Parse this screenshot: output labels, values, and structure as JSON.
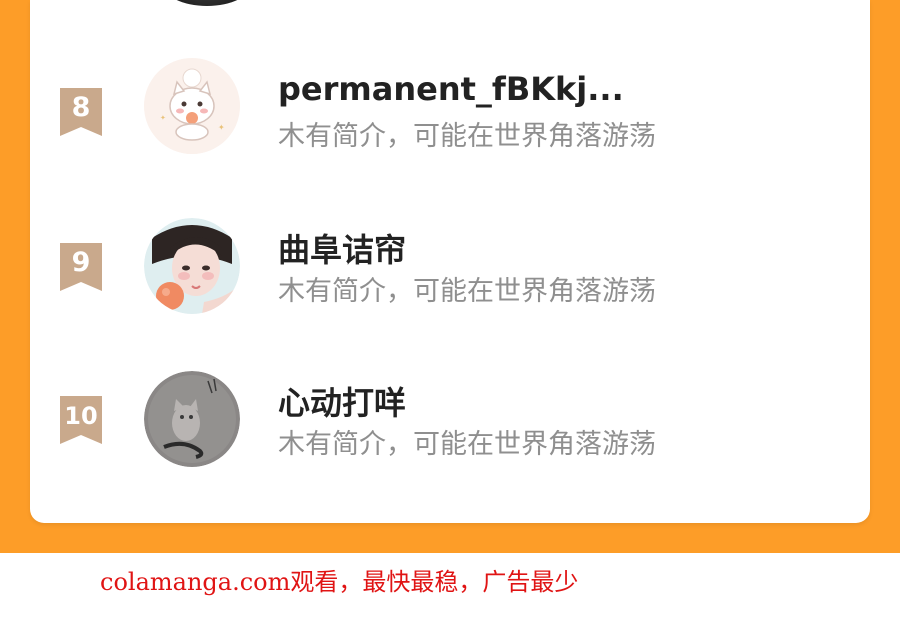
{
  "colors": {
    "frame": "#fd9d28",
    "card": "#ffffff",
    "badge": "#c9a98c",
    "name": "#222222",
    "intro": "#8f8f8f",
    "footer": "#e01414"
  },
  "ranking": {
    "items": [
      {
        "rank": "8",
        "name": "permanent_fBKkj...",
        "intro": "木有简介，可能在世界角落游荡",
        "avatar_icon": "cat-sticker-avatar-icon"
      },
      {
        "rank": "9",
        "name": "曲阜诘帘",
        "intro": "木有简介，可能在世界角落游荡",
        "avatar_icon": "girl-photo-avatar-icon"
      },
      {
        "rank": "10",
        "name": "心动打咩",
        "intro": "木有简介，可能在世界角落游荡",
        "avatar_icon": "grey-cat-avatar-icon"
      }
    ]
  },
  "footer": {
    "text": "colamanga.com观看，最快最稳，广告最少"
  }
}
